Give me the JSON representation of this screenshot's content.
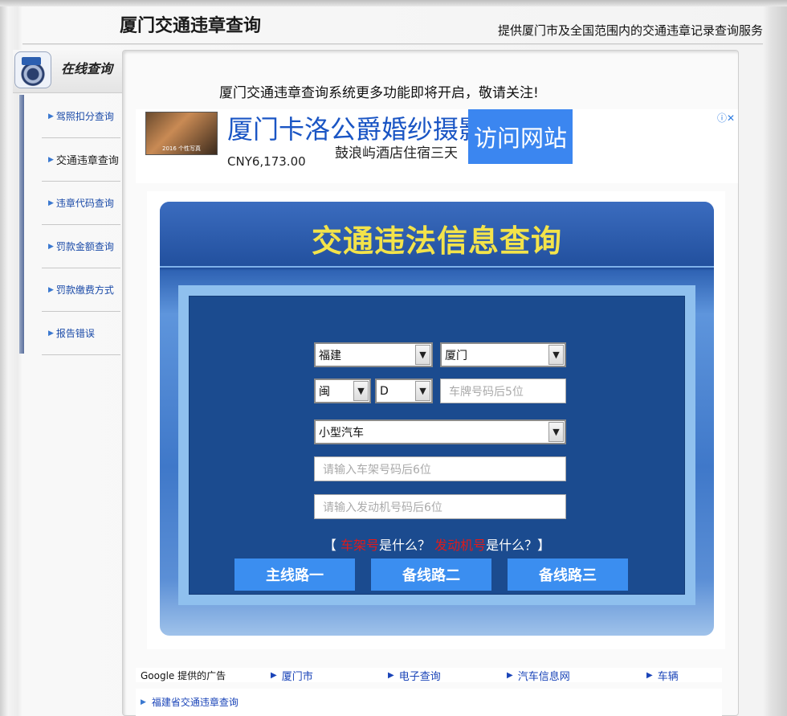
{
  "header": {
    "title": "厦门交通违章查询",
    "subtitle": "提供厦门市及全国范围内的交通违章记录查询服务"
  },
  "sidebar": {
    "badge_label": "在线查询",
    "items": [
      {
        "label": "驾照扣分查询"
      },
      {
        "label": "交通违章查询"
      },
      {
        "label": "违章代码查询"
      },
      {
        "label": "罚款金额查询"
      },
      {
        "label": "罚款缴费方式"
      },
      {
        "label": "报告错误"
      }
    ]
  },
  "main": {
    "notice": "厦门交通违章查询系统更多功能即将开启，敬请关注!",
    "ad": {
      "title": "厦门卡洛公爵婚纱摄影",
      "description": "鼓浪屿酒店住宿三天",
      "price": "CNY6,173.00",
      "button": "访问网站",
      "image_caption": "2016 个性写真"
    },
    "form": {
      "title": "交通违法信息查询",
      "province": "福建",
      "city": "厦门",
      "plate_prefix": "闽",
      "plate_letter": "D",
      "plate_placeholder": "车牌号码后5位",
      "vehicle_type": "小型汽车",
      "frame_placeholder": "请输入车架号码后6位",
      "engine_placeholder": "请输入发动机号码后6位",
      "help_open": "【",
      "help_frame_link": "车架号",
      "help_frame_q": "是什么？",
      "help_engine_link": "发动机号",
      "help_engine_q": "是什么？】",
      "buttons": [
        "主线路一",
        "备线路二",
        "备线路三"
      ]
    },
    "ad_links": {
      "label": "Google 提供的广告",
      "items": [
        "厦门市",
        "电子查询",
        "汽车信息网",
        "车辆"
      ]
    },
    "bottom_link": "福建省交通违章查询"
  }
}
